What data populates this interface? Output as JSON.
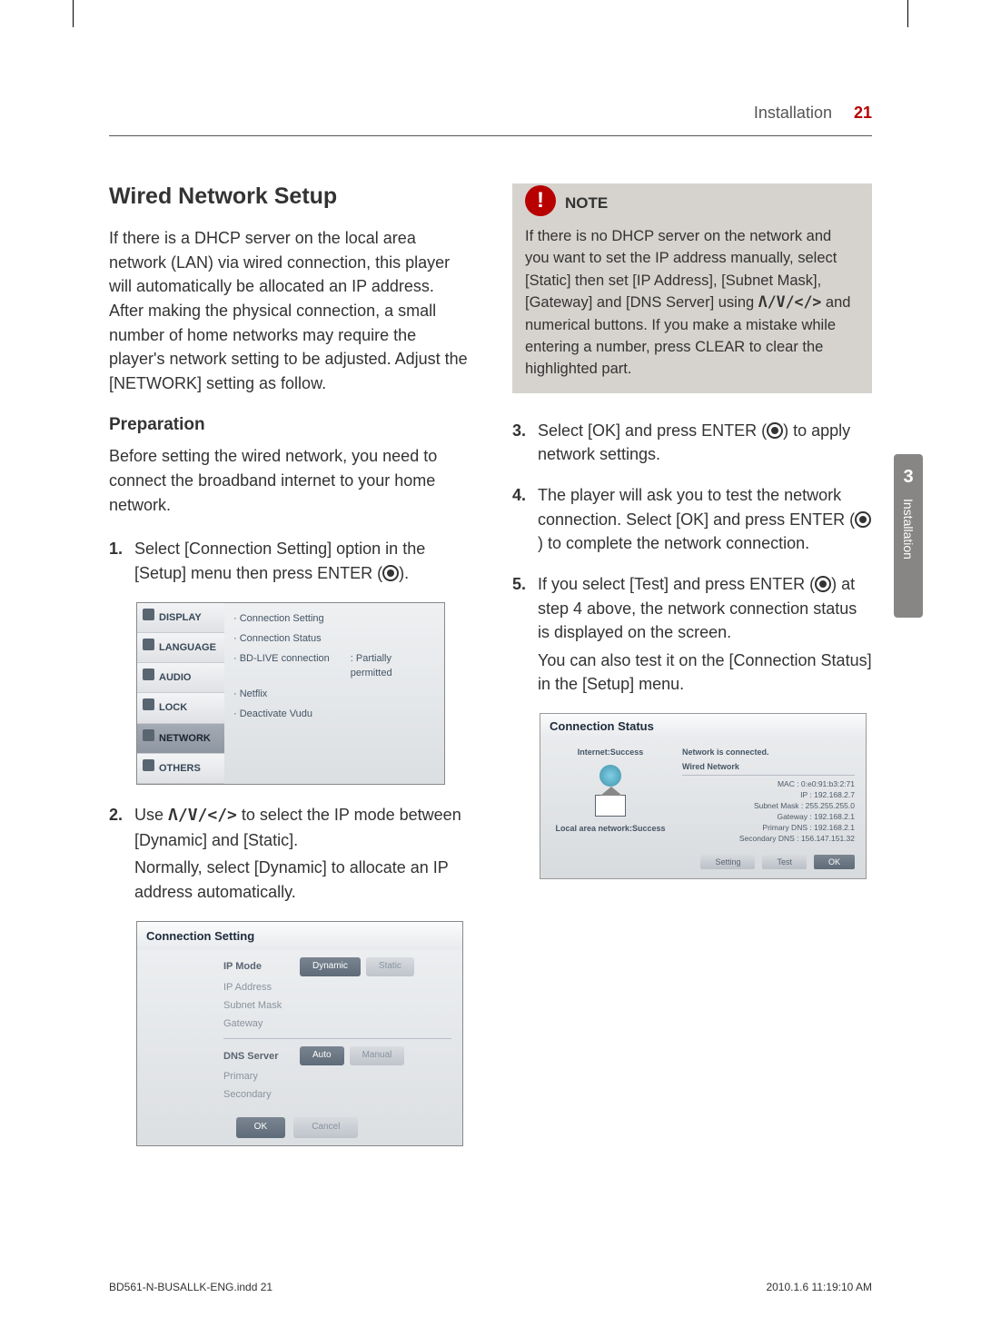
{
  "header": {
    "section": "Installation",
    "page": "21"
  },
  "side_tab": {
    "num": "3",
    "label": "Installation"
  },
  "left": {
    "h2": "Wired Network Setup",
    "intro": "If there is a DHCP server on the local area network (LAN) via wired connection, this player will automatically be allocated an IP address. After making the physical connection, a small number of home networks may require the player's network setting to be adjusted. Adjust the [NETWORK] setting as follow.",
    "h3": "Preparation",
    "prep_text": "Before setting the wired network, you need to connect the broadband internet to your home network.",
    "step1": "Select [Connection Setting] option in the [Setup] menu then press ENTER (",
    "step1_end": ").",
    "step2_a": "Use ",
    "step2_keys": "Λ/V/</>",
    "step2_b": " to select the IP mode between [Dynamic] and [Static].",
    "step2_c": "Normally, select [Dynamic] to allocate an IP address automatically.",
    "setup_menu": {
      "sidebar": [
        {
          "label": "DISPLAY"
        },
        {
          "label": "LANGUAGE"
        },
        {
          "label": "AUDIO"
        },
        {
          "label": "LOCK"
        },
        {
          "label": "NETWORK"
        },
        {
          "label": "OTHERS"
        }
      ],
      "options": [
        {
          "name": "· Connection Setting",
          "val": ""
        },
        {
          "name": "· Connection Status",
          "val": ""
        },
        {
          "name": "· BD-LIVE connection",
          "val": ": Partially permitted"
        },
        {
          "name": "· Netflix",
          "val": ""
        },
        {
          "name": "· Deactivate Vudu",
          "val": ""
        }
      ]
    },
    "conn_setting": {
      "title": "Connection Setting",
      "ip_mode": "IP Mode",
      "dynamic": "Dynamic",
      "static": "Static",
      "ip_address": "IP Address",
      "subnet_mask": "Subnet Mask",
      "gateway": "Gateway",
      "dns_server": "DNS Server",
      "auto": "Auto",
      "manual": "Manual",
      "primary": "Primary",
      "secondary": "Secondary",
      "ok": "OK",
      "cancel": "Cancel"
    }
  },
  "right": {
    "note_label": "NOTE",
    "note_text_a": "If there is no DHCP server on the network and you want to set the IP address manually, select [Static] then set [IP Address], [Subnet Mask], [Gateway] and [DNS Server] using ",
    "note_keys": "Λ/V/</>",
    "note_text_b": " and numerical buttons. If you make a mistake while entering a number, press CLEAR to clear the highlighted part.",
    "step3_a": "Select [OK] and press ENTER (",
    "step3_b": ") to apply network settings.",
    "step4_a": "The player will ask you to test the network connection. Select [OK] and press ENTER (",
    "step4_b": ") to complete the network connection.",
    "step5_a": "If you select [Test] and press ENTER (",
    "step5_b": ") at step 4 above, the network connection status is displayed on the screen.",
    "step5_c": "You can also test it on the [Connection Status] in the [Setup] menu.",
    "status": {
      "title": "Connection Status",
      "internet": "Internet:Success",
      "lan": "Local area network:Success",
      "connected": "Network is connected.",
      "wired": "Wired Network",
      "mac": "MAC : 0:e0:91:b3:2:71",
      "ip": "IP : 192.168.2.7",
      "subnet": "Subnet Mask : 255.255.255.0",
      "gateway": "Gateway : 192.168.2.1",
      "pdns": "Primary DNS : 192.168.2.1",
      "sdns": "Secondary DNS : 156.147.151.32",
      "setting": "Setting",
      "test": "Test",
      "ok": "OK"
    }
  },
  "footer": {
    "left": "BD561-N-BUSALLK-ENG.indd   21",
    "right": "2010.1.6   11:19:10 AM"
  }
}
